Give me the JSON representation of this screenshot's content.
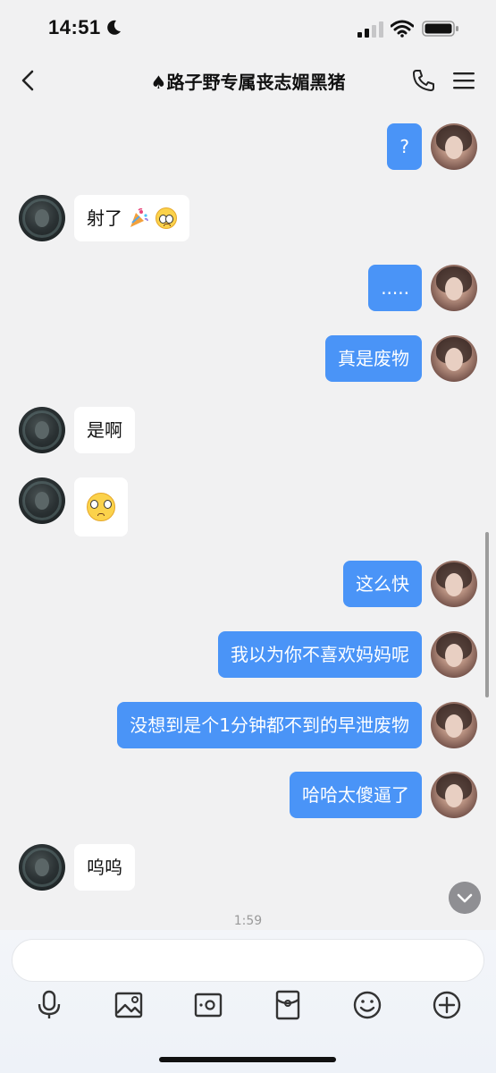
{
  "status_bar": {
    "time": "14:51"
  },
  "nav": {
    "title": "♠路子野专属丧志媚黑猪"
  },
  "messages": [
    {
      "side": "out",
      "text": "?"
    },
    {
      "side": "in",
      "text": "射了"
    },
    {
      "side": "out",
      "text": "....."
    },
    {
      "side": "out",
      "text": "真是废物"
    },
    {
      "side": "in",
      "text": "是啊"
    },
    {
      "side": "in",
      "text": ""
    },
    {
      "side": "out",
      "text": "这么快"
    },
    {
      "side": "out",
      "text": "我以为你不喜欢妈妈呢"
    },
    {
      "side": "out",
      "text": "没想到是个1分钟都不到的早泄废物"
    },
    {
      "side": "out",
      "text": "哈哈太傻逼了"
    },
    {
      "side": "in",
      "text": "呜呜"
    }
  ],
  "timestamp": "1:59",
  "input": {
    "placeholder": ""
  },
  "toolbar": [
    "microphone-icon",
    "image-icon",
    "camera-icon",
    "red-envelope-icon",
    "emoji-icon",
    "plus-icon"
  ]
}
